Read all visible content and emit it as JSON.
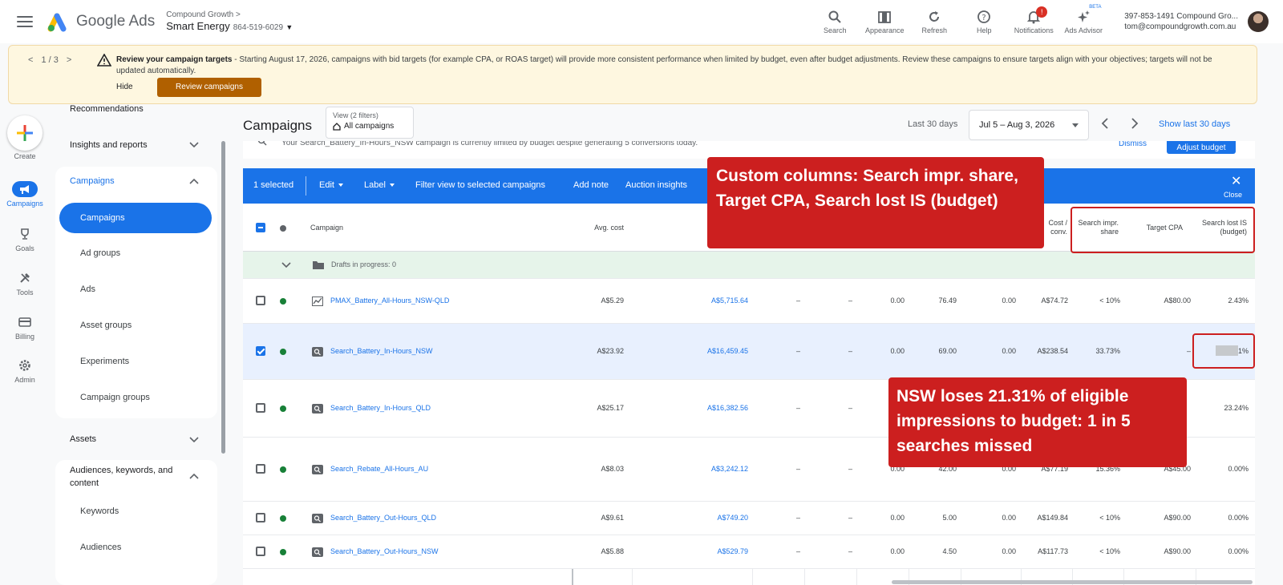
{
  "topbar": {
    "product": "Google Ads",
    "account_parent": "Compound Growth",
    "account_name": "Smart Energy",
    "account_id": "864-519-6029",
    "icons": [
      {
        "icon": "search-icon",
        "label": "Search"
      },
      {
        "icon": "appearance-icon",
        "label": "Appearance"
      },
      {
        "icon": "refresh-icon",
        "label": "Refresh"
      },
      {
        "icon": "help-icon",
        "label": "Help"
      },
      {
        "icon": "bell-icon",
        "label": "Notifications",
        "badge": "!"
      },
      {
        "icon": "sparkle-icon",
        "label": "Ads Advisor",
        "beta": "BETA"
      }
    ],
    "user_line1": "397-853-1491 Compound Gro...",
    "user_line2": "tom@compoundgrowth.com.au"
  },
  "notice": {
    "pager": "1 / 3",
    "title": "Review your campaign targets",
    "body": " - Starting August 17, 2026, campaigns with bid targets (for example CPA, or ROAS target) will provide more consistent performance when limited by budget, even after budget adjustments. Review these campaigns to ensure targets align with your objectives; targets will not be updated automatically.",
    "hide_label": "Hide",
    "review_label": "Review campaigns"
  },
  "rail": {
    "create_label": "Create",
    "items": [
      {
        "icon": "megaphone-icon",
        "label": "Campaigns"
      },
      {
        "icon": "trophy-icon",
        "label": "Goals"
      },
      {
        "icon": "tools-icon",
        "label": "Tools"
      },
      {
        "icon": "billing-icon",
        "label": "Billing"
      },
      {
        "icon": "gear-icon",
        "label": "Admin"
      }
    ]
  },
  "nav": {
    "recommendations": "Recommendations",
    "insights": "Insights and reports",
    "campaigns_section": "Campaigns",
    "campaigns_items": [
      "Campaigns",
      "Ad groups",
      "Ads",
      "Asset groups",
      "Experiments",
      "Campaign groups"
    ],
    "assets": "Assets",
    "audiences_section": "Audiences, keywords, and content",
    "audiences_items": [
      "Keywords",
      "Audiences"
    ]
  },
  "main": {
    "title": "Campaigns",
    "view_label": "View (2 filters)",
    "view_value": "All campaigns",
    "date_label": "Last 30 days",
    "date_range": "Jul 5 – Aug 3, 2026",
    "show_last": "Show last 30 days",
    "alert_text": "Your Search_Battery_In-Hours_NSW campaign is currently limited by budget despite generating 5 conversions today.",
    "dismiss": "Dismiss",
    "adjust_budget": "Adjust budget"
  },
  "actionbar": {
    "selected": "1 selected",
    "edit": "Edit",
    "label": "Label",
    "filter_view": "Filter view to selected campaigns",
    "add_note": "Add note",
    "auction": "Auction insights",
    "close": "Close"
  },
  "table": {
    "headers": {
      "campaign": "Campaign",
      "avg_cost": "Avg. cost",
      "cost_conv": "Cost / conv.",
      "search_impr_share": "Search impr. share",
      "target_cpa": "Target CPA",
      "search_lost_is": "Search lost IS (budget)"
    },
    "drafts": "Drafts in progress: 0",
    "rows": [
      {
        "type": "pmax",
        "name": "PMAX_Battery_All-Hours_NSW-QLD",
        "avg_cost": "A$5.29",
        "cost": "A$5,715.64",
        "c3": "–",
        "c4": "–",
        "c5": "0.00",
        "conv": "76.49",
        "c7": "0.00",
        "cost_conv": "A$74.72",
        "impr_share": "< 10%",
        "target_cpa": "A$80.00",
        "lost_is": "2.43%",
        "selected": false
      },
      {
        "type": "search",
        "name": "Search_Battery_In-Hours_NSW",
        "avg_cost": "A$23.92",
        "cost": "A$16,459.45",
        "c3": "–",
        "c4": "–",
        "c5": "0.00",
        "conv": "69.00",
        "c7": "0.00",
        "cost_conv": "A$238.54",
        "impr_share": "33.73%",
        "target_cpa": "–",
        "lost_is": "21.31%",
        "selected": true
      },
      {
        "type": "search",
        "name": "Search_Battery_In-Hours_QLD",
        "avg_cost": "A$25.17",
        "cost": "A$16,382.56",
        "c3": "–",
        "c4": "–",
        "c5": "",
        "conv": "",
        "c7": "",
        "cost_conv": "",
        "impr_share": "",
        "target_cpa": "",
        "lost_is": "23.24%",
        "selected": false
      },
      {
        "type": "search",
        "name": "Search_Rebate_All-Hours_AU",
        "avg_cost": "A$8.03",
        "cost": "A$3,242.12",
        "c3": "–",
        "c4": "–",
        "c5": "0.00",
        "conv": "42.00",
        "c7": "0.00",
        "cost_conv": "A$77.19",
        "impr_share": "15.36%",
        "target_cpa": "A$45.00",
        "lost_is": "0.00%",
        "selected": false
      },
      {
        "type": "search",
        "name": "Search_Battery_Out-Hours_QLD",
        "avg_cost": "A$9.61",
        "cost": "A$749.20",
        "c3": "–",
        "c4": "–",
        "c5": "0.00",
        "conv": "5.00",
        "c7": "0.00",
        "cost_conv": "A$149.84",
        "impr_share": "< 10%",
        "target_cpa": "A$90.00",
        "lost_is": "0.00%",
        "selected": false
      },
      {
        "type": "search",
        "name": "Search_Battery_Out-Hours_NSW",
        "avg_cost": "A$5.88",
        "cost": "A$529.79",
        "c3": "–",
        "c4": "–",
        "c5": "0.00",
        "conv": "4.50",
        "c7": "0.00",
        "cost_conv": "A$117.73",
        "impr_share": "< 10%",
        "target_cpa": "A$90.00",
        "lost_is": "0.00%",
        "selected": false
      }
    ]
  },
  "annotations": {
    "columns_callout": "Custom columns: Search impr. share, Target CPA, Search lost IS (budget)",
    "nsw_callout": "NSW loses 21.31% of eligible impressions to budget: 1 in 5 searches missed"
  },
  "colors": {
    "brand_blue": "#1a73e8",
    "annotation_red": "#cc1f1f",
    "review_button": "#b06000"
  }
}
